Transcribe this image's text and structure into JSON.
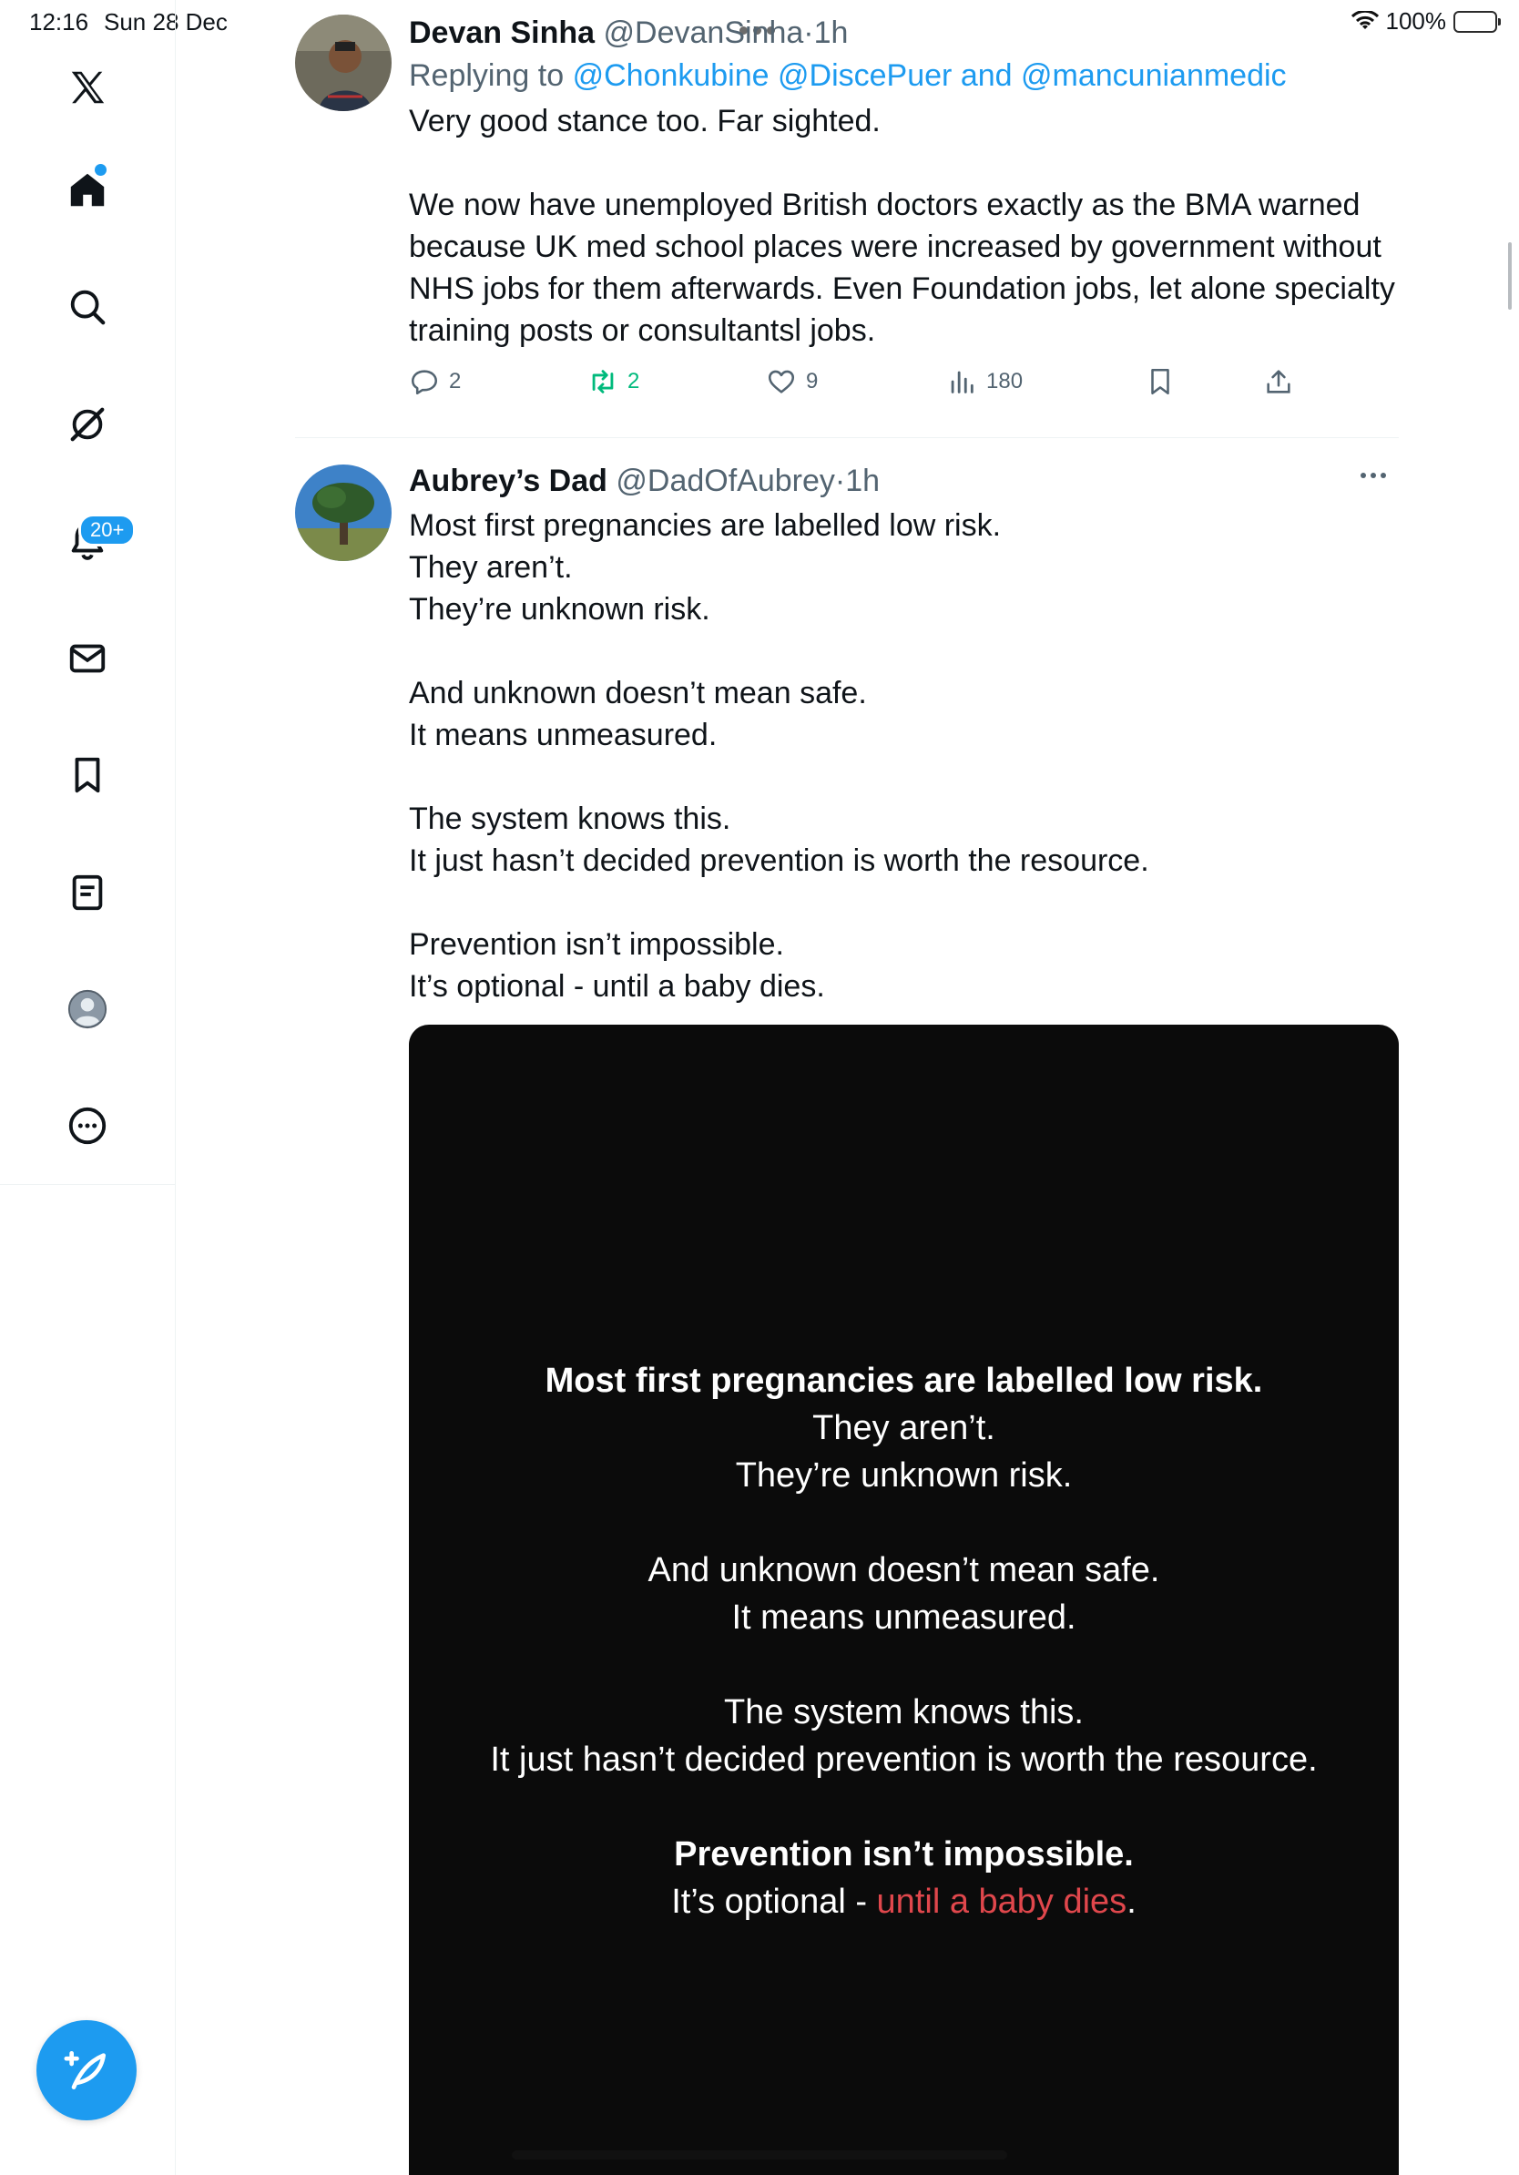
{
  "status_bar": {
    "time": "12:16",
    "date": "Sun 28 Dec",
    "battery": "100%"
  },
  "sidebar": {
    "items": [
      {
        "icon": "x-logo-icon"
      },
      {
        "icon": "home-icon"
      },
      {
        "icon": "search-icon"
      },
      {
        "icon": "grok-icon"
      },
      {
        "icon": "bell-icon",
        "badge": "20+"
      },
      {
        "icon": "mail-icon"
      },
      {
        "icon": "bookmark-icon"
      },
      {
        "icon": "lists-icon"
      },
      {
        "icon": "profile-icon"
      },
      {
        "icon": "more-circle-icon"
      }
    ],
    "compose_icon": "compose-feather-icon"
  },
  "tweets": [
    {
      "name": "Devan Sinha",
      "handle": "@DevanSinha",
      "sep": "·",
      "time": "1h",
      "replying_prefix": "Replying to",
      "mention1": "@Chonkubine",
      "mention2": "@DiscePuer",
      "and": "and",
      "mention3": "@mancunianmedic",
      "text1": "Very good stance too. Far sighted.",
      "text2": "We now have unemployed British doctors exactly as the BMA warned because UK med school places were increased by government without NHS jobs for them afterwards. Even Foundation jobs, let alone specialty training posts or consultantsl jobs.",
      "replies": "2",
      "reposts": "2",
      "likes": "9",
      "views": "180"
    },
    {
      "name": "Aubrey’s Dad",
      "handle": "@DadOfAubrey",
      "sep": "·",
      "time": "1h",
      "lines": [
        "Most first pregnancies are labelled low risk.",
        "They aren’t.",
        "They’re unknown risk.",
        "And unknown doesn’t mean safe.",
        "It means unmeasured.",
        "The system knows this.",
        "It just hasn’t decided prevention is worth the resource.",
        "Prevention isn’t impossible.",
        "It’s optional - until a baby dies."
      ],
      "media": {
        "l1": "Most first pregnancies are labelled low risk.",
        "l2": "They aren’t.",
        "l3": "They’re unknown risk.",
        "l4": "And unknown doesn’t mean safe.",
        "l5": "It means unmeasured.",
        "l6": "The system knows this.",
        "l7": "It just hasn’t decided prevention is worth the resource.",
        "l8": "Prevention isn’t impossible.",
        "l9a": "It’s optional - ",
        "l9b": "until a baby dies",
        "l9c": "."
      }
    }
  ],
  "colors": {
    "accent": "#1d9bf0",
    "repost_green": "#00ba7c",
    "media_red": "#e0474c"
  }
}
